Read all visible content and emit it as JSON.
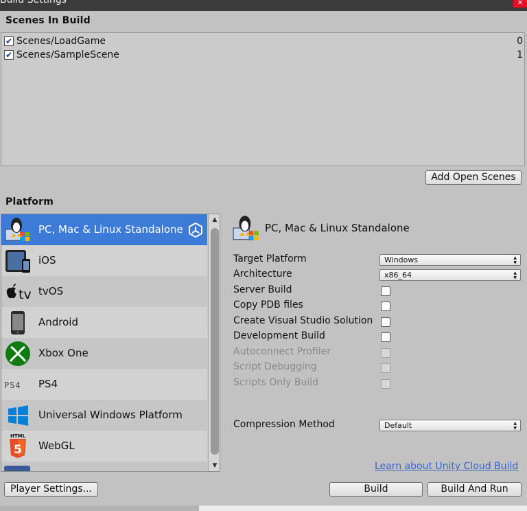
{
  "window": {
    "title": "Build Settings"
  },
  "scenes": {
    "heading": "Scenes In Build",
    "items": [
      {
        "name": "Scenes/LoadGame",
        "index": "0",
        "checked": true
      },
      {
        "name": "Scenes/SampleScene",
        "index": "1",
        "checked": true
      }
    ],
    "add_open_scenes_label": "Add Open Scenes"
  },
  "platform": {
    "heading": "Platform",
    "items": [
      {
        "label": "PC, Mac & Linux Standalone",
        "icon": "standalone-icon",
        "selected": true
      },
      {
        "label": "iOS",
        "icon": "ios-icon"
      },
      {
        "label": "tvOS",
        "icon": "tvos-icon"
      },
      {
        "label": "Android",
        "icon": "android-icon"
      },
      {
        "label": "Xbox One",
        "icon": "xbox-icon"
      },
      {
        "label": "PS4",
        "icon": "ps4-icon"
      },
      {
        "label": "Universal Windows Platform",
        "icon": "windows-icon"
      },
      {
        "label": "WebGL",
        "icon": "html5-icon"
      }
    ]
  },
  "detail": {
    "title": "PC, Mac & Linux Standalone",
    "target_platform_label": "Target Platform",
    "target_platform_value": "Windows",
    "architecture_label": "Architecture",
    "architecture_value": "x86_64",
    "server_build_label": "Server Build",
    "copy_pdb_label": "Copy PDB files",
    "create_vs_label": "Create Visual Studio Solution",
    "development_build_label": "Development Build",
    "autoconnect_label": "Autoconnect Profiler",
    "script_debugging_label": "Script Debugging",
    "scripts_only_label": "Scripts Only Build",
    "compression_label": "Compression Method",
    "compression_value": "Default",
    "cloud_build_link": "Learn about Unity Cloud Build"
  },
  "buttons": {
    "player_settings": "Player Settings...",
    "build": "Build",
    "build_and_run": "Build And Run"
  },
  "colors": {
    "selection": "#3d7bd9",
    "link": "#3a63c8"
  }
}
